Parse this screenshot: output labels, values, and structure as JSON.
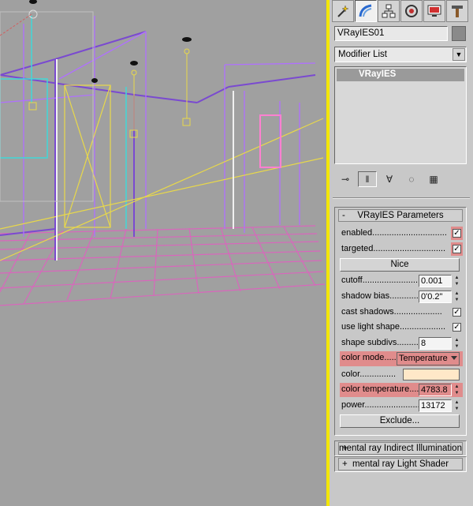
{
  "viewport": {
    "label": "Perspective viewport (wireframe)"
  },
  "tabs": [
    {
      "icon": "create-icon"
    },
    {
      "icon": "modify-icon"
    },
    {
      "icon": "hierarchy-icon"
    },
    {
      "icon": "motion-icon"
    },
    {
      "icon": "display-icon"
    },
    {
      "icon": "utilities-icon"
    }
  ],
  "object": {
    "name": "VRayIES01",
    "color": "#8a8a8a"
  },
  "modifier_list": {
    "selected": "Modifier List"
  },
  "stack": {
    "items": [
      "VRayIES"
    ]
  },
  "rollout": {
    "title": "VRayIES Parameters",
    "collapse_symbol": "-",
    "enabled_label": "enabled...............................",
    "enabled_check": "✓",
    "targeted_label": "targeted..............................",
    "targeted_check": "✓",
    "nice_button": "Nice",
    "cutoff_label": "cutoff.........................",
    "cutoff_value": "0.001",
    "shadow_bias_label": "shadow bias............",
    "shadow_bias_value": "0'0.2\"",
    "cast_shadows_label": "cast shadows....................",
    "cast_shadows_check": "✓",
    "use_light_shape_label": "use light shape...................",
    "use_light_shape_check": "✓",
    "shape_subdivs_label": "shape subdivs.........",
    "shape_subdivs_value": "8",
    "color_mode_label": "color mode.....",
    "color_mode_value": "Temperature",
    "color_label": "color...............",
    "color_swatch": "#ffe8c8",
    "color_temperature_label": "color temperature.....",
    "color_temperature_value": "4783.8",
    "power_label": "power...........................",
    "power_value": "13172",
    "exclude_button": "Exclude..."
  },
  "collapsed_rollouts": [
    {
      "symbol": "+",
      "title": "mental ray Indirect Illumination"
    },
    {
      "symbol": "+",
      "title": "mental ray Light Shader"
    }
  ],
  "highlight_color": "#e08c8c"
}
